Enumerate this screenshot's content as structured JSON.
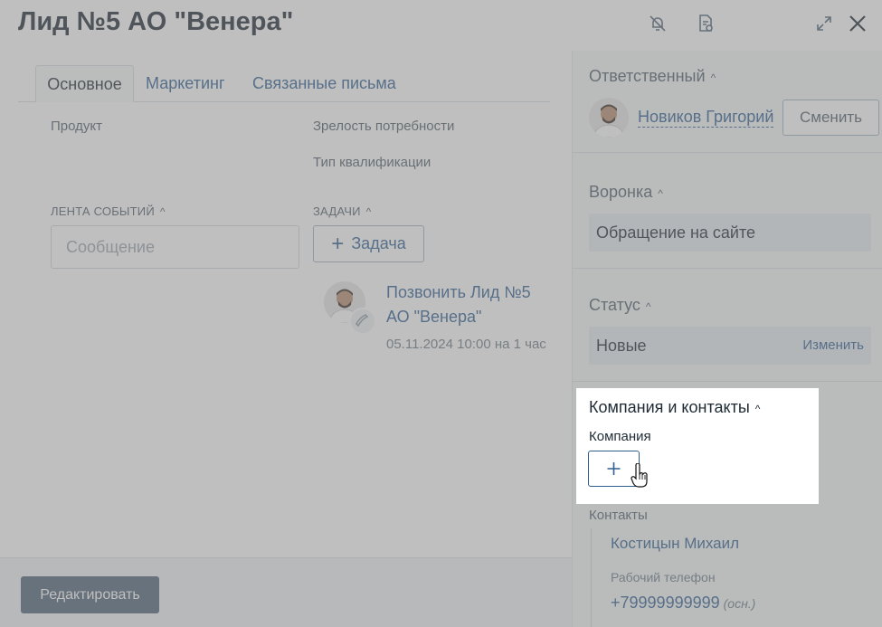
{
  "header": {
    "title": "Лид №5 АО \"Венера\"",
    "icons": [
      "notification-off-icon",
      "document-settings-icon",
      "expand-icon",
      "close-icon"
    ]
  },
  "tabs": [
    {
      "label": "Основное",
      "active": true
    },
    {
      "label": "Маркетинг",
      "active": false
    },
    {
      "label": "Связанные письма",
      "active": false
    }
  ],
  "fields": {
    "product": "Продукт",
    "need_maturity": "Зрелость потребности",
    "qualification_type": "Тип квалификации"
  },
  "feed": {
    "label": "ЛЕНТА СОБЫТИЙ",
    "placeholder": "Сообщение"
  },
  "tasks": {
    "label": "ЗАДАЧИ",
    "add_label": "Задача",
    "items": [
      {
        "title": "Позвонить Лид №5 АО \"Венера\"",
        "meta": "05.11.2024 10:00 на 1 час",
        "icon": "phone-icon"
      }
    ]
  },
  "footer": {
    "edit_label": "Редактировать"
  },
  "sidebar": {
    "responsible": {
      "label": "Ответственный",
      "name": "Новиков Григорий",
      "change_label": "Сменить"
    },
    "funnel": {
      "label": "Воронка",
      "value": "Обращение на сайте"
    },
    "status": {
      "label": "Статус",
      "value": "Новые",
      "change_label": "Изменить"
    },
    "company_contacts": {
      "label": "Компания и контакты",
      "company_label": "Компания",
      "contacts_label": "Контакты",
      "contact_name": "Костицын Михаил",
      "phone_label": "Рабочий телефон",
      "phone": "+79999999999",
      "phone_note": "(осн.)"
    }
  },
  "colors": {
    "accent": "#2e5f92",
    "text": "#1f2b34",
    "overlay": "rgba(128,128,128,0.5)"
  }
}
